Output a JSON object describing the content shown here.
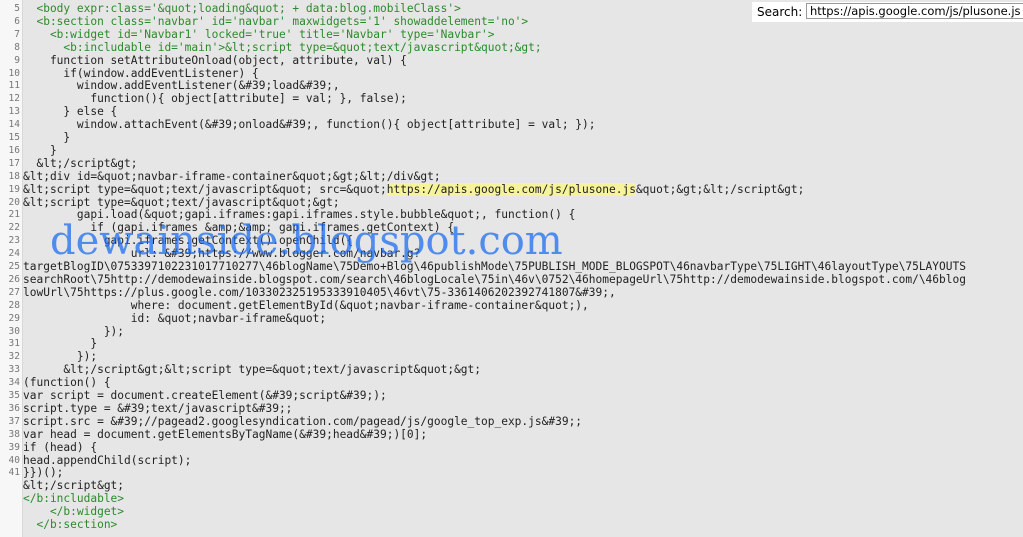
{
  "search": {
    "label": "Search:",
    "value": "https://apis.google.com/js/plusone.js"
  },
  "watermark": "dewainside.blogspot.com",
  "line_numbers": [
    "5",
    "6",
    "7",
    "8",
    "9",
    "10",
    "11",
    "12",
    "13",
    "14",
    "15",
    "16",
    "17",
    "18",
    "19",
    "20",
    "21",
    "22",
    "23",
    "24",
    "25",
    "26",
    "27",
    "28",
    "29",
    "30",
    "31",
    "32",
    "33",
    "34",
    "35",
    "36",
    "37",
    "38",
    "39",
    "40",
    "41"
  ],
  "code_lines": [
    {
      "xml": true,
      "text": "  <body expr:class='&quot;loading&quot; + data:blog.mobileClass'>"
    },
    {
      "xml": true,
      "text": "  <b:section class='navbar' id='navbar' maxwidgets='1' showaddelement='no'>"
    },
    {
      "xml": true,
      "text": "    <b:widget id='Navbar1' locked='true' title='Navbar' type='Navbar'>"
    },
    {
      "xml": true,
      "text": "      <b:includable id='main'>&lt;script type=&quot;text/javascript&quot;&gt;"
    },
    {
      "xml": false,
      "text": "    function setAttributeOnload(object, attribute, val) {"
    },
    {
      "xml": false,
      "text": "      if(window.addEventListener) {"
    },
    {
      "xml": false,
      "text": "        window.addEventListener(&#39;load&#39;,"
    },
    {
      "xml": false,
      "text": "          function(){ object[attribute] = val; }, false);"
    },
    {
      "xml": false,
      "text": "      } else {"
    },
    {
      "xml": false,
      "text": "        window.attachEvent(&#39;onload&#39;, function(){ object[attribute] = val; });"
    },
    {
      "xml": false,
      "text": "      }"
    },
    {
      "xml": false,
      "text": "    }"
    },
    {
      "xml": false,
      "text": "  &lt;/script&gt;"
    },
    {
      "xml": false,
      "text": "&lt;div id=&quot;navbar-iframe-container&quot;&gt;&lt;/div&gt;"
    },
    {
      "xml": false,
      "text": "&lt;script type=&quot;text/javascript&quot; src=&quot;",
      "hl": "https://apis.google.com/js/plusone.js",
      "after": "&quot;&gt;&lt;/script&gt;"
    },
    {
      "xml": false,
      "text": "&lt;script type=&quot;text/javascript&quot;&gt;"
    },
    {
      "xml": false,
      "text": "        gapi.load(&quot;gapi.iframes:gapi.iframes.style.bubble&quot;, function() {"
    },
    {
      "xml": false,
      "text": "          if (gapi.iframes &amp;&amp; gapi.iframes.getContext) {"
    },
    {
      "xml": false,
      "text": "            gapi.iframes.getContext().openChild({"
    },
    {
      "xml": false,
      "text": "                url: &#39;https://www.blogger.com/navbar.g?"
    },
    {
      "xml": false,
      "text": "targetBlogID\\0753397102231017710277\\46blogName\\75Demo+Blog\\46publishMode\\75PUBLISH_MODE_BLOGSPOT\\46navbarType\\75LIGHT\\46layoutType\\75LAYOUTS"
    },
    {
      "xml": false,
      "text": "searchRoot\\75http://demodewainside.blogspot.com/search\\46blogLocale\\75in\\46v\\0752\\46homepageUrl\\75http://demodewainside.blogspot.com/\\46blog"
    },
    {
      "xml": false,
      "text": "lowUrl\\75https://plus.google.com/103302325195333910405\\46vt\\75-3361406202392741807&#39;,"
    },
    {
      "xml": false,
      "text": "                where: document.getElementById(&quot;navbar-iframe-container&quot;),"
    },
    {
      "xml": false,
      "text": "                id: &quot;navbar-iframe&quot;"
    },
    {
      "xml": false,
      "text": "            });"
    },
    {
      "xml": false,
      "text": "          }"
    },
    {
      "xml": false,
      "text": "        });"
    },
    {
      "xml": false,
      "text": "      &lt;/script&gt;&lt;script type=&quot;text/javascript&quot;&gt;"
    },
    {
      "xml": false,
      "text": "(function() {"
    },
    {
      "xml": false,
      "text": "var script = document.createElement(&#39;script&#39;);"
    },
    {
      "xml": false,
      "text": "script.type = &#39;text/javascript&#39;;"
    },
    {
      "xml": false,
      "text": "script.src = &#39;//pagead2.googlesyndication.com/pagead/js/google_top_exp.js&#39;;"
    },
    {
      "xml": false,
      "text": "var head = document.getElementsByTagName(&#39;head&#39;)[0];"
    },
    {
      "xml": false,
      "text": "if (head) {"
    },
    {
      "xml": false,
      "text": "head.appendChild(script);"
    },
    {
      "xml": false,
      "text": "}})();"
    },
    {
      "xml": false,
      "text": "&lt;/script&gt;"
    },
    {
      "xml": true,
      "text": "</b:includable>"
    },
    {
      "xml": true,
      "text": "    </b:widget>"
    },
    {
      "xml": true,
      "text": "  </b:section>"
    }
  ]
}
